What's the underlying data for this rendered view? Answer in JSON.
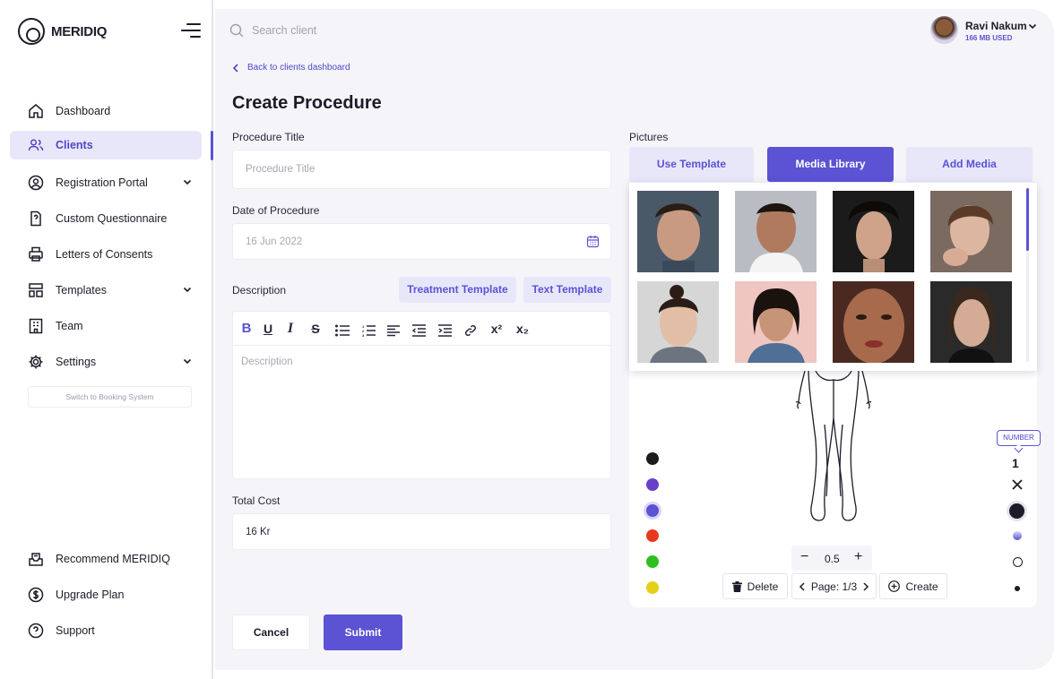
{
  "brand": {
    "name": "MERIDIQ"
  },
  "header": {
    "search_placeholder": "Search client",
    "user_name": "Ravi Nakum",
    "storage_used": "166 MB USED"
  },
  "sidebar": {
    "items": [
      {
        "label": "Dashboard",
        "icon": "home-icon"
      },
      {
        "label": "Clients",
        "icon": "users-icon",
        "active": true
      },
      {
        "label": "Registration Portal",
        "icon": "user-circle-icon",
        "expandable": true
      },
      {
        "label": "Custom Questionnaire",
        "icon": "question-doc-icon"
      },
      {
        "label": "Letters of Consents",
        "icon": "printer-icon"
      },
      {
        "label": "Templates",
        "icon": "layout-icon",
        "expandable": true
      },
      {
        "label": "Team",
        "icon": "building-icon"
      },
      {
        "label": "Settings",
        "icon": "gear-icon",
        "expandable": true
      }
    ],
    "switch_label": "Switch to Booking System",
    "bottom_items": [
      {
        "label": "Recommend MERIDIQ",
        "icon": "inbox-icon"
      },
      {
        "label": "Upgrade Plan",
        "icon": "dollar-icon"
      },
      {
        "label": "Support",
        "icon": "help-icon"
      }
    ]
  },
  "page": {
    "back_link": "Back to clients dashboard",
    "title": "Create Procedure"
  },
  "form": {
    "procedure_title_label": "Procedure Title",
    "procedure_title_placeholder": "Procedure Title",
    "date_label": "Date of Procedure",
    "date_value": "16 Jun 2022",
    "description_label": "Description",
    "treatment_template": "Treatment Template",
    "text_template": "Text Template",
    "description_placeholder": "Description",
    "total_cost_label": "Total Cost",
    "total_cost_value": "16 Kr",
    "cancel": "Cancel",
    "submit": "Submit"
  },
  "editor_toolbar": [
    "B",
    "U",
    "I",
    "S",
    "bullets",
    "numbers",
    "align-left",
    "outdent",
    "indent",
    "link",
    "x²",
    "x₂"
  ],
  "pictures": {
    "label": "Pictures",
    "tabs": [
      {
        "label": "Use  Template",
        "active": false
      },
      {
        "label": "Media Library",
        "active": true
      },
      {
        "label": "Add Media",
        "active": false
      }
    ],
    "thumbnails": 8
  },
  "drawing": {
    "colors": [
      "#1c1c1c",
      "#6a3fc8",
      "#5b52d4",
      "#e8391d",
      "#2fbf1f",
      "#e6cf1a"
    ],
    "tooltip": "NUMBER",
    "number_tool": "1",
    "zoom": "0.5",
    "delete": "Delete",
    "page": "Page: 1/3",
    "create": "Create"
  }
}
